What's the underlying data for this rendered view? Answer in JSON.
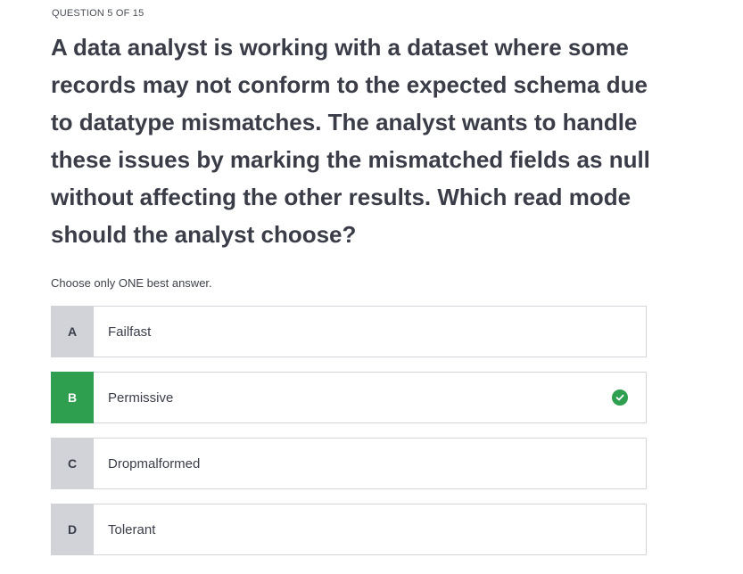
{
  "progress": "QUESTION 5 OF 15",
  "question": "A data analyst is working with a dataset where some records may not conform to the expected schema due to datatype mismatches. The analyst wants to handle these issues by marking the mismatched fields as null without affecting the other results. Which read mode should the analyst choose?",
  "instruction": "Choose only ONE best answer.",
  "options": [
    {
      "letter": "A",
      "label": "Failfast",
      "correct": false
    },
    {
      "letter": "B",
      "label": "Permissive",
      "correct": true
    },
    {
      "letter": "C",
      "label": "Dropmalformed",
      "correct": false
    },
    {
      "letter": "D",
      "label": "Tolerant",
      "correct": false
    }
  ],
  "colors": {
    "correct": "#2e9e4f",
    "letter_bg": "#d1d3d9",
    "border": "#d3d5db",
    "text": "#3b3e4a"
  },
  "icons": {
    "correct_marker": "check-circle-icon"
  }
}
